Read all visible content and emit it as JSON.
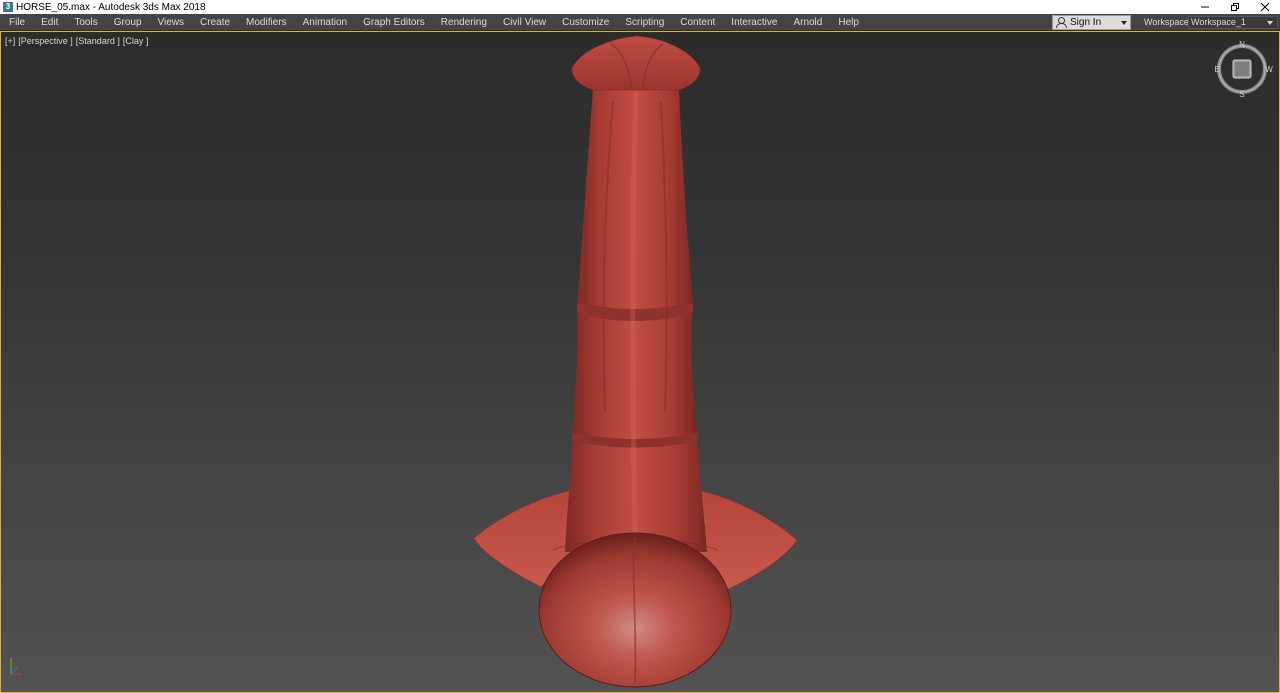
{
  "window": {
    "icon": "3",
    "title": "HORSE_05.max - Autodesk 3ds Max 2018",
    "minimize_icon": "minimize-icon",
    "restore_icon": "restore-icon",
    "close_icon": "close-icon"
  },
  "menu": {
    "items": [
      "File",
      "Edit",
      "Tools",
      "Group",
      "Views",
      "Create",
      "Modifiers",
      "Animation",
      "Graph Editors",
      "Rendering",
      "Civil View",
      "Customize",
      "Scripting",
      "Content",
      "Interactive",
      "Arnold",
      "Help"
    ],
    "sign_in": "Sign In",
    "workspaces_label": "Workspaces:",
    "workspace_value": "Workspace_1"
  },
  "viewport": {
    "labels": [
      "[+]",
      "[Perspective ]",
      "[Standard ]",
      "[Clay ]"
    ],
    "viewcube": {
      "north": "N",
      "south": "S",
      "east": "E",
      "west": "W"
    },
    "border_color": "#d6b43a",
    "model_color": "#b5443a"
  }
}
